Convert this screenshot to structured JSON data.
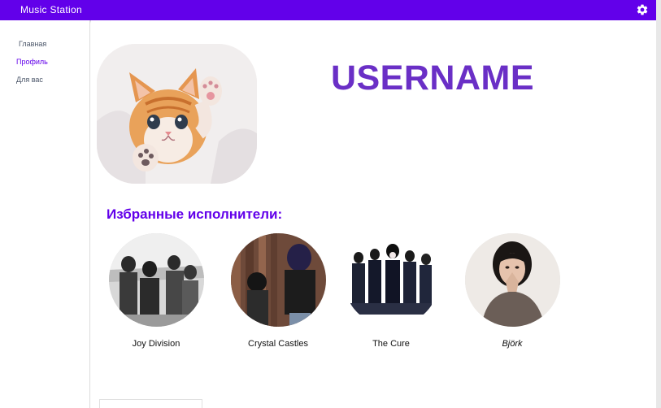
{
  "app": {
    "title": "Music Station",
    "settings_icon": "gear-icon",
    "accent_color": "#6200ea"
  },
  "sidebar": {
    "items": [
      {
        "label": "Главная",
        "active": false
      },
      {
        "label": "Профиль",
        "active": true
      },
      {
        "label": "Для вас",
        "active": false
      }
    ]
  },
  "profile": {
    "username": "USERNAME",
    "avatar": "kitten-photo"
  },
  "favorites": {
    "title": "Избранные исполнители:",
    "artists": [
      {
        "name": "Joy Division"
      },
      {
        "name": "Crystal Castles"
      },
      {
        "name": "The Cure"
      },
      {
        "name": "Björk"
      }
    ]
  }
}
